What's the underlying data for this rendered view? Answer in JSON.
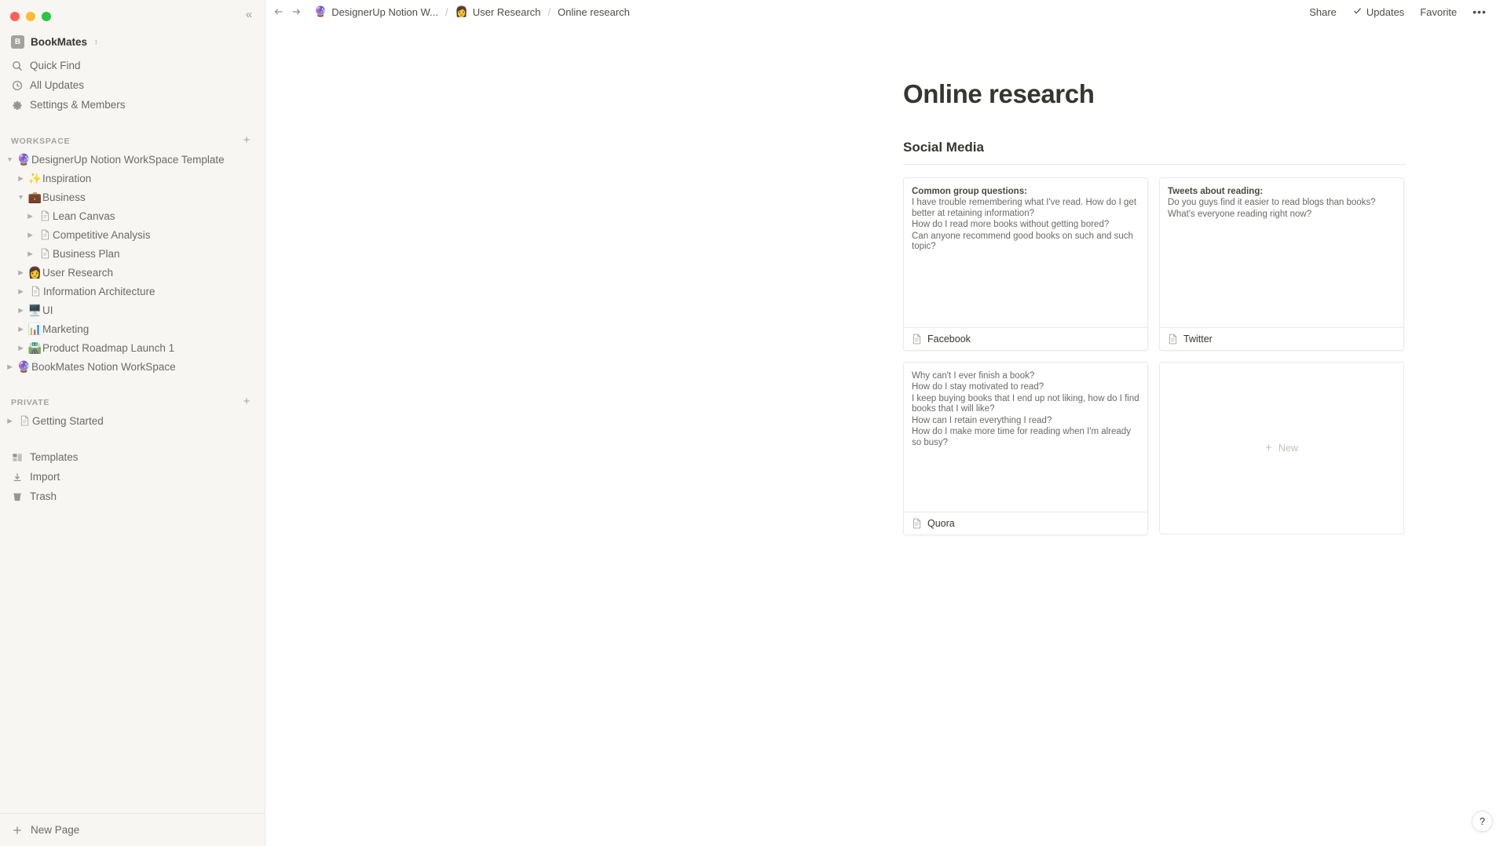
{
  "window": {
    "traffic_lights": [
      "close",
      "minimize",
      "maximize"
    ],
    "colors": {
      "close": "#ff5f57",
      "minimize": "#febc2e",
      "maximize": "#28c840"
    }
  },
  "sidebar": {
    "collapse_icon": "chevrons-left-icon",
    "workspace": {
      "avatar_letter": "B",
      "name": "BookMates",
      "switcher_icon": "chevron-updown-icon"
    },
    "nav": [
      {
        "label": "Quick Find",
        "icon": "search-icon"
      },
      {
        "label": "All Updates",
        "icon": "clock-icon"
      },
      {
        "label": "Settings & Members",
        "icon": "gear-icon"
      }
    ],
    "workspace_section": {
      "title": "WORKSPACE",
      "add_icon": "plus-icon",
      "items": [
        {
          "label": "DesignerUp Notion WorkSpace Template",
          "emoji": "🔮",
          "indent": 0,
          "expanded": true,
          "twisty": "▼"
        },
        {
          "label": "Inspiration",
          "emoji": "✨",
          "indent": 1,
          "expanded": false,
          "twisty": "▶"
        },
        {
          "label": "Business",
          "emoji": "💼",
          "indent": 1,
          "expanded": true,
          "twisty": "▼"
        },
        {
          "label": "Lean Canvas",
          "emoji": "",
          "icon": "document-icon",
          "indent": 2,
          "expanded": false,
          "twisty": "▶"
        },
        {
          "label": "Competitive Analysis",
          "emoji": "",
          "icon": "document-icon",
          "indent": 2,
          "expanded": false,
          "twisty": "▶"
        },
        {
          "label": "Business Plan",
          "emoji": "",
          "icon": "document-icon",
          "indent": 2,
          "expanded": false,
          "twisty": "▶"
        },
        {
          "label": "User Research",
          "emoji": "👩",
          "indent": 1,
          "expanded": false,
          "twisty": "▶"
        },
        {
          "label": "Information Architecture",
          "emoji": "",
          "icon": "document-icon",
          "indent": 1,
          "expanded": false,
          "twisty": "▶"
        },
        {
          "label": "UI",
          "emoji": "🖥️",
          "indent": 1,
          "expanded": false,
          "twisty": "▶"
        },
        {
          "label": "Marketing",
          "emoji": "📊",
          "indent": 1,
          "expanded": false,
          "twisty": "▶"
        },
        {
          "label": "Product Roadmap Launch 1",
          "emoji": "🛣️",
          "indent": 1,
          "expanded": false,
          "twisty": "▶"
        },
        {
          "label": "BookMates Notion WorkSpace",
          "emoji": "🔮",
          "indent": 0,
          "expanded": false,
          "twisty": "▶"
        }
      ]
    },
    "private_section": {
      "title": "PRIVATE",
      "add_icon": "plus-icon",
      "items": [
        {
          "label": "Getting Started",
          "emoji": "",
          "icon": "document-icon",
          "indent": 0,
          "expanded": false,
          "twisty": "▶"
        }
      ]
    },
    "footer_nav": [
      {
        "label": "Templates",
        "icon": "templates-icon"
      },
      {
        "label": "Import",
        "icon": "import-icon"
      },
      {
        "label": "Trash",
        "icon": "trash-icon"
      }
    ],
    "new_page": {
      "label": "New Page",
      "icon": "plus-icon"
    }
  },
  "topbar": {
    "back_icon": "arrow-left-icon",
    "forward_icon": "arrow-right-icon",
    "breadcrumbs": [
      {
        "label": "DesignerUp Notion W...",
        "emoji": "🔮"
      },
      {
        "label": "User Research",
        "emoji": "👩"
      },
      {
        "label": "Online research",
        "emoji": ""
      }
    ],
    "separator": "/",
    "actions": [
      {
        "label": "Share",
        "icon": ""
      },
      {
        "label": "Updates",
        "icon": "check-icon"
      },
      {
        "label": "Favorite",
        "icon": ""
      }
    ],
    "more_label": "•••"
  },
  "page": {
    "title": "Online research",
    "subheading": "Social Media",
    "cards": [
      {
        "title": "Facebook",
        "icon": "document-icon",
        "preview": [
          {
            "text": "Common group questions:",
            "bold": true
          },
          {
            "text": "I have trouble remembering what I've read. How do I get better at retaining information?",
            "bold": false
          },
          {
            "text": "How do I read more books without getting bored?",
            "bold": false
          },
          {
            "text": "Can anyone recommend good books on such and such topic?",
            "bold": false
          }
        ]
      },
      {
        "title": "Twitter",
        "icon": "document-icon",
        "preview": [
          {
            "text": "Tweets about reading:",
            "bold": true
          },
          {
            "text": "Do you guys find it easier to read blogs than books?",
            "bold": false
          },
          {
            "text": "What's everyone reading right now?",
            "bold": false
          }
        ]
      },
      {
        "title": "Quora",
        "icon": "document-icon",
        "preview": [
          {
            "text": "Why can't I ever finish a book?",
            "bold": false
          },
          {
            "text": "How do I stay motivated to read?",
            "bold": false
          },
          {
            "text": "I keep buying books that I end up not liking, how do I find books that I will like?",
            "bold": false
          },
          {
            "text": "How can I retain everything I read?",
            "bold": false
          },
          {
            "text": "How do I make more time for reading when I'm already so busy?",
            "bold": false
          }
        ]
      }
    ],
    "new_card": {
      "label": "New",
      "plus": "+"
    }
  },
  "help": {
    "label": "?"
  }
}
